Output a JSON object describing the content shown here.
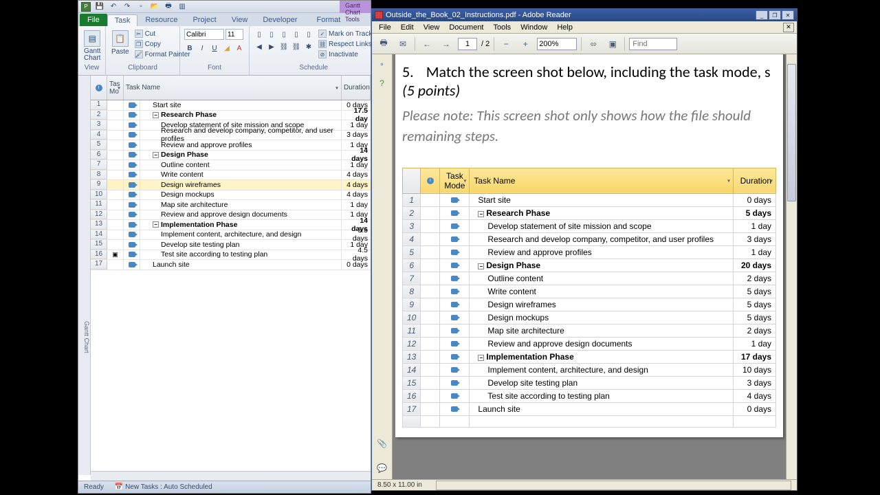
{
  "project": {
    "tabs": {
      "file": "File",
      "task": "Task",
      "resource": "Resource",
      "project": "Project",
      "view": "View",
      "developer": "Developer",
      "format": "Format"
    },
    "context_tab": "Gantt Chart Tools",
    "ribbon": {
      "view_grp": "View",
      "gantt": "Gantt\nChart",
      "clipboard_grp": "Clipboard",
      "paste": "Paste",
      "cut": "Cut",
      "copy": "Copy",
      "format_painter": "Format Painter",
      "font_grp": "Font",
      "font_name": "Calibri",
      "font_size": "11",
      "schedule_grp": "Schedule",
      "mark_on_track": "Mark on Track",
      "respect_links": "Respect Links",
      "inactivate": "Inactivate"
    },
    "cols": {
      "i": "",
      "tm": "Tas\nMo",
      "tn": "Task Name",
      "dur": "Duration"
    },
    "rows": [
      {
        "n": 1,
        "name": "Start site",
        "dur": "0 days",
        "indent": 1
      },
      {
        "n": 2,
        "name": "Research Phase",
        "dur": "17.5 day",
        "indent": 1,
        "bold": true,
        "outline": true
      },
      {
        "n": 3,
        "name": "Develop statement of site mission and scope",
        "dur": "1 day",
        "indent": 2
      },
      {
        "n": 4,
        "name": "Research and develop company, competitor, and user profiles",
        "dur": "3 days",
        "indent": 2
      },
      {
        "n": 5,
        "name": "Review and approve profiles",
        "dur": "1 day",
        "indent": 2
      },
      {
        "n": 6,
        "name": "Design Phase",
        "dur": "14 days",
        "indent": 1,
        "bold": true,
        "outline": true
      },
      {
        "n": 7,
        "name": "Outline content",
        "dur": "1 day",
        "indent": 2
      },
      {
        "n": 8,
        "name": "Write content",
        "dur": "4 days",
        "indent": 2
      },
      {
        "n": 9,
        "name": "Design wireframes",
        "dur": "4 days",
        "indent": 2,
        "sel": true
      },
      {
        "n": 10,
        "name": "Design mockups",
        "dur": "4 days",
        "indent": 2
      },
      {
        "n": 11,
        "name": "Map site architecture",
        "dur": "1 day",
        "indent": 2
      },
      {
        "n": 12,
        "name": "Review and approve design documents",
        "dur": "1 day",
        "indent": 2
      },
      {
        "n": 13,
        "name": "Implementation Phase",
        "dur": "14 days",
        "indent": 1,
        "bold": true,
        "outline": true
      },
      {
        "n": 14,
        "name": "Implement content, architecture, and design",
        "dur": "5.5 days",
        "indent": 2
      },
      {
        "n": 15,
        "name": "Develop site testing plan",
        "dur": "1 day",
        "indent": 2
      },
      {
        "n": 16,
        "name": "Test site according to testing plan",
        "dur": "4.5 days",
        "indent": 2,
        "info": true
      },
      {
        "n": 17,
        "name": "Launch site",
        "dur": "0 days",
        "indent": 1
      }
    ],
    "side_label": "Gantt Chart",
    "status": {
      "ready": "Ready",
      "sched": "New Tasks : Auto Scheduled"
    }
  },
  "reader": {
    "title": "Outside_the_Book_02_Instructions.pdf - Adobe Reader",
    "menus": [
      "File",
      "Edit",
      "View",
      "Document",
      "Tools",
      "Window",
      "Help"
    ],
    "page_cur": "1",
    "page_tot": "/ 2",
    "zoom": "200%",
    "find_ph": "Find",
    "question": {
      "num": "5.",
      "text": "Match the screen shot below, including the task mode, s",
      "points": "(5 points)",
      "note_l1": "Please note: This screen shot only shows how the file should",
      "note_l2": "remaining steps."
    },
    "shot_cols": {
      "i": "",
      "tm": "Task\nMode",
      "tn": "Task Name",
      "dur": "Duration"
    },
    "shot_rows": [
      {
        "n": 1,
        "name": "Start site",
        "dur": "0 days",
        "indent": 1
      },
      {
        "n": 2,
        "name": "Research Phase",
        "dur": "5 days",
        "indent": 1,
        "bold": true,
        "outline": true
      },
      {
        "n": 3,
        "name": "Develop statement of site mission and scope",
        "dur": "1 day",
        "indent": 2
      },
      {
        "n": 4,
        "name": "Research and develop company, competitor, and user profiles",
        "dur": "3 days",
        "indent": 2
      },
      {
        "n": 5,
        "name": "Review and approve profiles",
        "dur": "1 day",
        "indent": 2
      },
      {
        "n": 6,
        "name": "Design Phase",
        "dur": "20 days",
        "indent": 1,
        "bold": true,
        "outline": true
      },
      {
        "n": 7,
        "name": "Outline content",
        "dur": "2 days",
        "indent": 2
      },
      {
        "n": 8,
        "name": "Write content",
        "dur": "5 days",
        "indent": 2
      },
      {
        "n": 9,
        "name": "Design wireframes",
        "dur": "5 days",
        "indent": 2
      },
      {
        "n": 10,
        "name": "Design mockups",
        "dur": "5 days",
        "indent": 2
      },
      {
        "n": 11,
        "name": "Map site architecture",
        "dur": "2 days",
        "indent": 2
      },
      {
        "n": 12,
        "name": "Review and approve design documents",
        "dur": "1 day",
        "indent": 2
      },
      {
        "n": 13,
        "name": "Implementation Phase",
        "dur": "17 days",
        "indent": 1,
        "bold": true,
        "outline": true
      },
      {
        "n": 14,
        "name": "Implement content, architecture, and design",
        "dur": "10 days",
        "indent": 2
      },
      {
        "n": 15,
        "name": "Develop site testing plan",
        "dur": "3 days",
        "indent": 2
      },
      {
        "n": 16,
        "name": "Test site according to testing plan",
        "dur": "4 days",
        "indent": 2
      },
      {
        "n": 17,
        "name": "Launch site",
        "dur": "0 days",
        "indent": 1
      }
    ],
    "status_dim": "8.50 x 11.00 in"
  }
}
